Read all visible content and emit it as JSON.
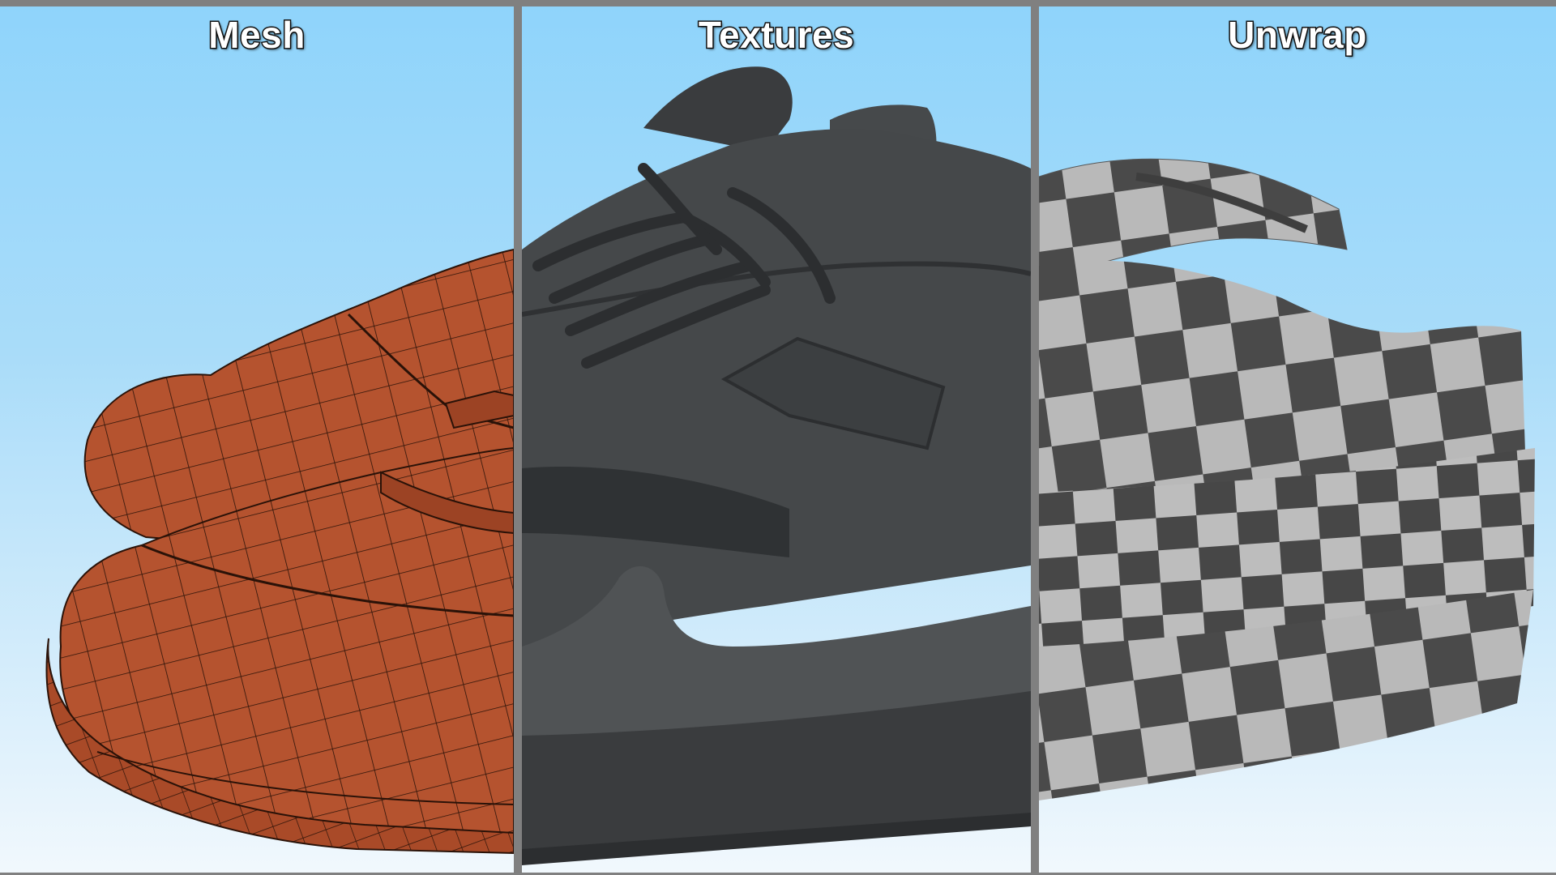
{
  "panels": [
    {
      "id": "mesh",
      "title": "Mesh"
    },
    {
      "id": "textures",
      "title": "Textures"
    },
    {
      "id": "unwrap",
      "title": "Unwrap"
    }
  ],
  "colors": {
    "sky_top": "#8fd4fb",
    "sky_bottom": "#f1f8fd",
    "mesh_fill": "#b5532f",
    "mesh_wire": "#2a1208",
    "texture_dark": "#3f4244",
    "checker_dark": "#4a4a4a",
    "checker_light": "#b9b9b9",
    "divider": "#808080"
  }
}
